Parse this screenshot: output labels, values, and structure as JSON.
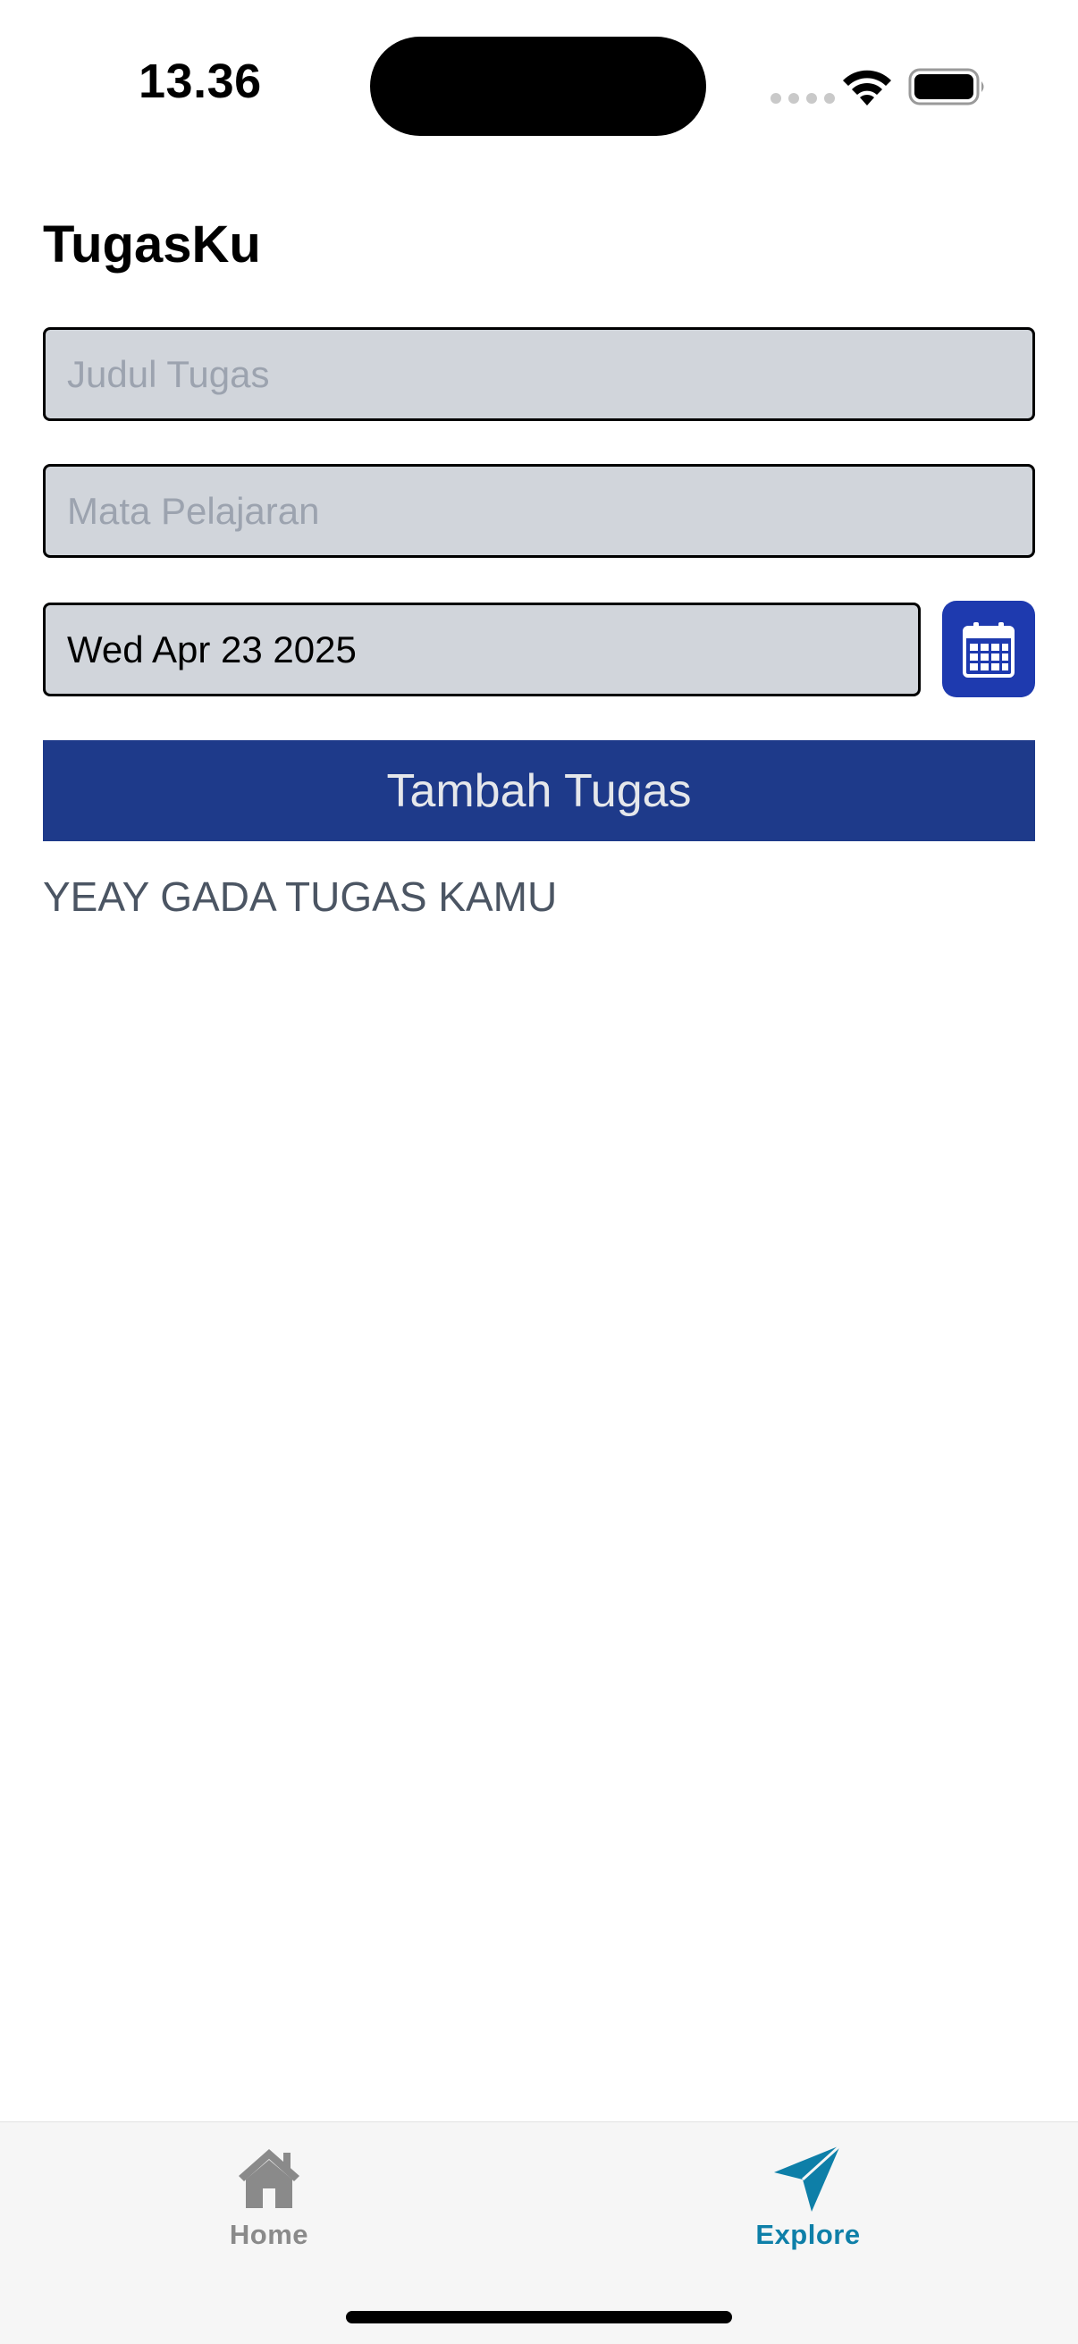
{
  "status_bar": {
    "time": "13.36"
  },
  "app": {
    "title": "TugasKu"
  },
  "form": {
    "title_placeholder": "Judul Tugas",
    "title_value": "",
    "subject_placeholder": "Mata Pelajaran",
    "subject_value": "",
    "date_value": "Wed Apr 23 2025",
    "add_button_label": "Tambah Tugas"
  },
  "tasks": {
    "empty_message": "YEAY GADA TUGAS KAMU",
    "items": []
  },
  "tab_bar": {
    "tabs": [
      {
        "label": "Home",
        "icon": "home-icon",
        "active": false
      },
      {
        "label": "Explore",
        "icon": "paper-plane-icon",
        "active": true
      }
    ]
  },
  "colors": {
    "primary": "#1e3a8a",
    "calendar_button": "#1e3aaf",
    "input_background": "#d1d5db",
    "active_tab": "#0e7fa8",
    "inactive_tab": "#8a8a8a",
    "empty_text": "#4b5563"
  }
}
